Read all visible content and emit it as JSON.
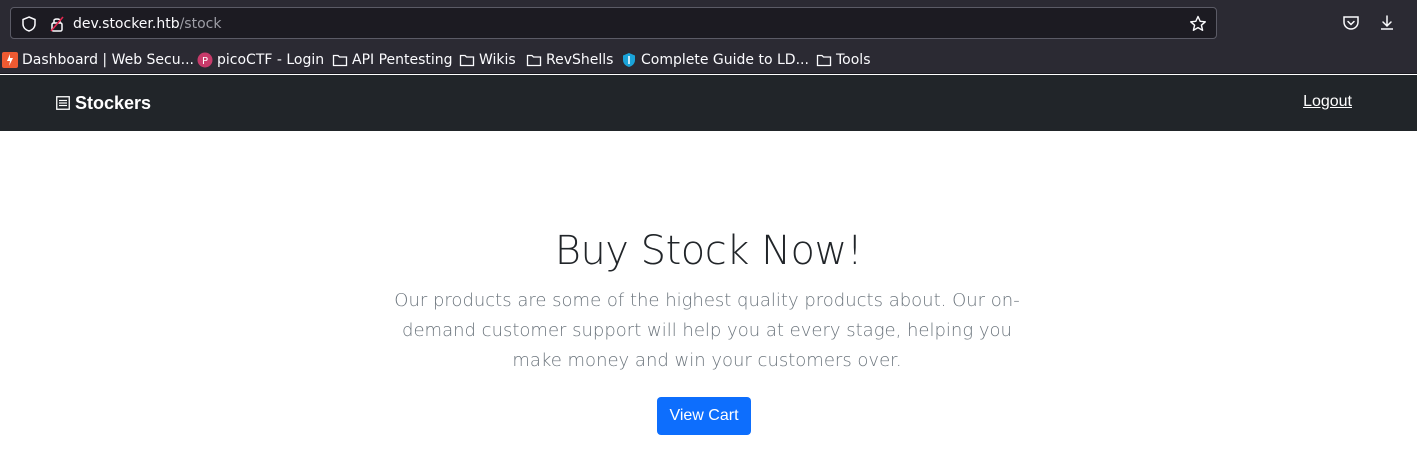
{
  "browser": {
    "url_scheme": "",
    "url_host": "dev.stocker.htb",
    "url_path": "/stock",
    "icons": [
      "shield-icon",
      "lock-icon",
      "star-icon",
      "pocket-icon",
      "download-icon"
    ]
  },
  "bookmarks": [
    {
      "label": "Dashboard | Web Secu...",
      "icon": "hackerone-icon"
    },
    {
      "label": "picoCTF - Login",
      "icon": "picoctf-icon"
    },
    {
      "label": "API Pentesting",
      "icon": "folder-icon"
    },
    {
      "label": "Wikis",
      "icon": "folder-icon"
    },
    {
      "label": "RevShells",
      "icon": "folder-icon"
    },
    {
      "label": "Complete Guide to LD...",
      "icon": "shield-blue-icon"
    },
    {
      "label": "Tools",
      "icon": "folder-icon"
    }
  ],
  "navbar": {
    "brand": "Stockers",
    "logout": "Logout"
  },
  "hero": {
    "title": "Buy Stock Now!",
    "text": "Our products are some of the highest quality products about. Our on-demand customer support will help you at every stage, helping you make money and win your customers over.",
    "button": "View Cart"
  },
  "colors": {
    "navbar_bg": "#212529",
    "button_bg": "#0d6efd",
    "chrome_bg": "#2b2a33"
  }
}
